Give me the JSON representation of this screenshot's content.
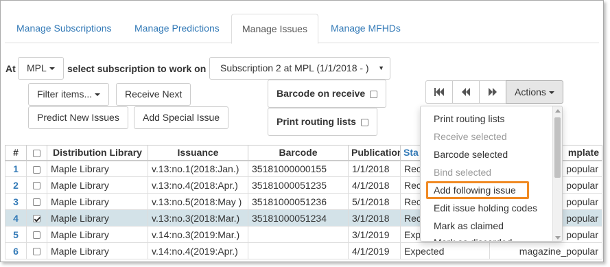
{
  "tabs": [
    {
      "label": "Manage Subscriptions"
    },
    {
      "label": "Manage Predictions"
    },
    {
      "label": "Manage Issues"
    },
    {
      "label": "Manage MFHDs"
    }
  ],
  "toolbar": {
    "at_label": "At",
    "library_select": "MPL",
    "select_subscription_label": "select subscription to work on",
    "subscription_select": "Subscription 2 at MPL (1/1/2018 - )",
    "filter_button": "Filter items...",
    "receive_next_button": "Receive Next",
    "predict_button": "Predict New Issues",
    "special_issue_button": "Add Special Issue",
    "barcode_on_receive": "Barcode on receive",
    "print_routing_lists": "Print routing lists",
    "actions_button": "Actions",
    "first_page_icon": "first-page-icon",
    "prev_page_icon": "previous-page-icon",
    "next_page_icon": "next-page-icon"
  },
  "actions_menu": {
    "items": [
      {
        "label": "Print routing lists",
        "disabled": false
      },
      {
        "label": "Receive selected",
        "disabled": true
      },
      {
        "label": "Barcode selected",
        "disabled": false
      },
      {
        "label": "Bind selected",
        "disabled": true
      },
      {
        "label": "Add following issue",
        "disabled": false,
        "highlighted": true
      },
      {
        "label": "Edit issue holding codes",
        "disabled": false
      },
      {
        "label": "Mark as claimed",
        "disabled": false
      },
      {
        "label": "Mark as discarded",
        "disabled": false
      }
    ]
  },
  "table": {
    "headers": [
      "#",
      "",
      "Distribution Library",
      "Issuance",
      "Barcode",
      "Publication",
      "Status",
      "Template"
    ],
    "header_partial": {
      "status": "Sta",
      "template": "mplate"
    },
    "rows": [
      {
        "num": "1",
        "checked": false,
        "library": "Maple Library",
        "issuance": "v.13:no.1(2018:Jan.)",
        "barcode": "35181000000155",
        "publication": "1/1/2018",
        "status": "Rec",
        "template": "popular"
      },
      {
        "num": "2",
        "checked": false,
        "library": "Maple Library",
        "issuance": "v.13:no.4(2018:Apr.)",
        "barcode": "35181000051235",
        "publication": "4/1/2018",
        "status": "Rec",
        "template": "popular"
      },
      {
        "num": "3",
        "checked": false,
        "library": "Maple Library",
        "issuance": "v.13:no.5(2018:May )",
        "barcode": "35181000051236",
        "publication": "5/1/2018",
        "status": "Rec",
        "template": "popular"
      },
      {
        "num": "4",
        "checked": true,
        "library": "Maple Library",
        "issuance": "v.13:no.3(2018:Mar.)",
        "barcode": "35181000051234",
        "publication": "3/1/2018",
        "status": "Rec",
        "template": "popular"
      },
      {
        "num": "5",
        "checked": false,
        "library": "Maple Library",
        "issuance": "v.14:no.3(2019:Mar.)",
        "barcode": "",
        "publication": "3/1/2019",
        "status": "Expe",
        "template": "popular"
      },
      {
        "num": "6",
        "checked": false,
        "library": "Maple Library",
        "issuance": "v.14:no.4(2019:Apr.)",
        "barcode": "",
        "publication": "4/1/2019",
        "status": "Expected",
        "template": "magazine_popular"
      }
    ]
  },
  "colors": {
    "link": "#337ab7",
    "selected_row": "#d3e2e8",
    "highlight_outline": "#f08a24"
  }
}
